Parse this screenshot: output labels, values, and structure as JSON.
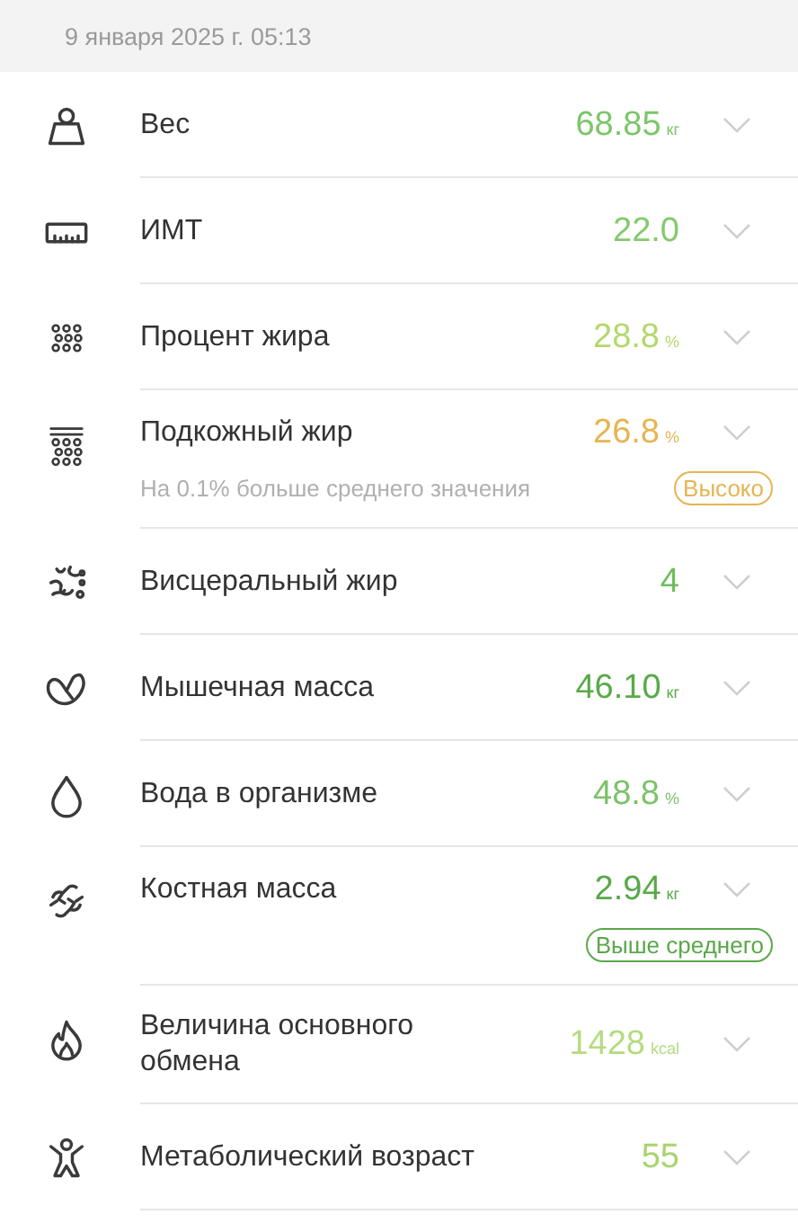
{
  "header": {
    "date": "9 января 2025 г. 05:13"
  },
  "metrics": [
    {
      "label": "Вес",
      "value": "68.85",
      "unit": "кг",
      "color": "#7cc66a"
    },
    {
      "label": "ИМТ",
      "value": "22.0",
      "color": "#86c96e"
    },
    {
      "label": "Процент жира",
      "value": "28.8",
      "unit": "%",
      "color": "#b3d86c"
    },
    {
      "label": "Подкожный жир",
      "value": "26.8",
      "unit": "%",
      "color": "#e6b552",
      "note": "На 0.1% больше среднего значения",
      "badge": {
        "text": "Высоко",
        "color": "#e6b552"
      }
    },
    {
      "label": "Висцеральный жир",
      "value": "4",
      "color": "#6cbf5a"
    },
    {
      "label": "Мышечная масса",
      "value": "46.10",
      "unit": "кг",
      "color": "#5aaa4a"
    },
    {
      "label": "Вода в организме",
      "value": "48.8",
      "unit": "%",
      "color": "#7cc26a"
    },
    {
      "label": "Костная масса",
      "value": "2.94",
      "unit": "кг",
      "color": "#5aa84a",
      "badge": {
        "text": "Выше среднего",
        "color": "#5aa84a"
      }
    },
    {
      "label": "Величина основного обмена",
      "value": "1428",
      "unit": "kcal",
      "color": "#b5db80"
    },
    {
      "label": "Метаболический возраст",
      "value": "55",
      "color": "#a8d470"
    }
  ]
}
